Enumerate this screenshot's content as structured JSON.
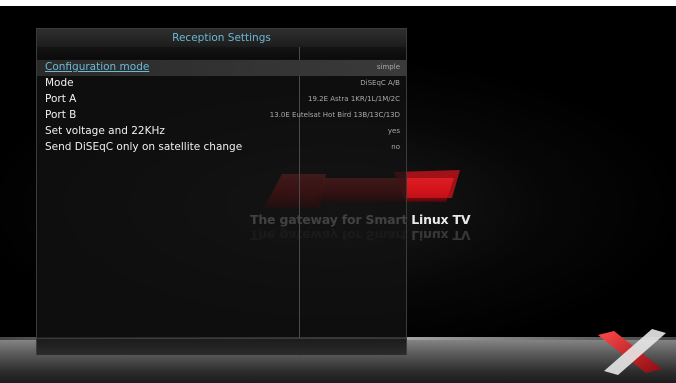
{
  "window": {
    "title": "Reception Settings"
  },
  "settings": [
    {
      "label": "Configuration mode",
      "value": "simple",
      "selected": true
    },
    {
      "label": "Mode",
      "value": "DiSEqC A/B",
      "selected": false
    },
    {
      "label": "Port A",
      "value": "19.2E Astra 1KR/1L/1M/2C",
      "selected": false
    },
    {
      "label": "Port B",
      "value": "13.0E Eutelsat Hot Bird 13B/13C/13D",
      "selected": false
    },
    {
      "label": "Set voltage and 22KHz",
      "value": "yes",
      "selected": false
    },
    {
      "label": "Send DiSEqC only on satellite change",
      "value": "no",
      "selected": false
    }
  ],
  "branding": {
    "logo": "Xtrend",
    "tagline": "The gateway for Smart Linux TV",
    "corner_icon": "x-logo-icon"
  },
  "colors": {
    "accent": "#6ab9d6",
    "logo_red": "#c8121a",
    "text": "#f0f0f0",
    "value_text": "#a9a9a9"
  }
}
